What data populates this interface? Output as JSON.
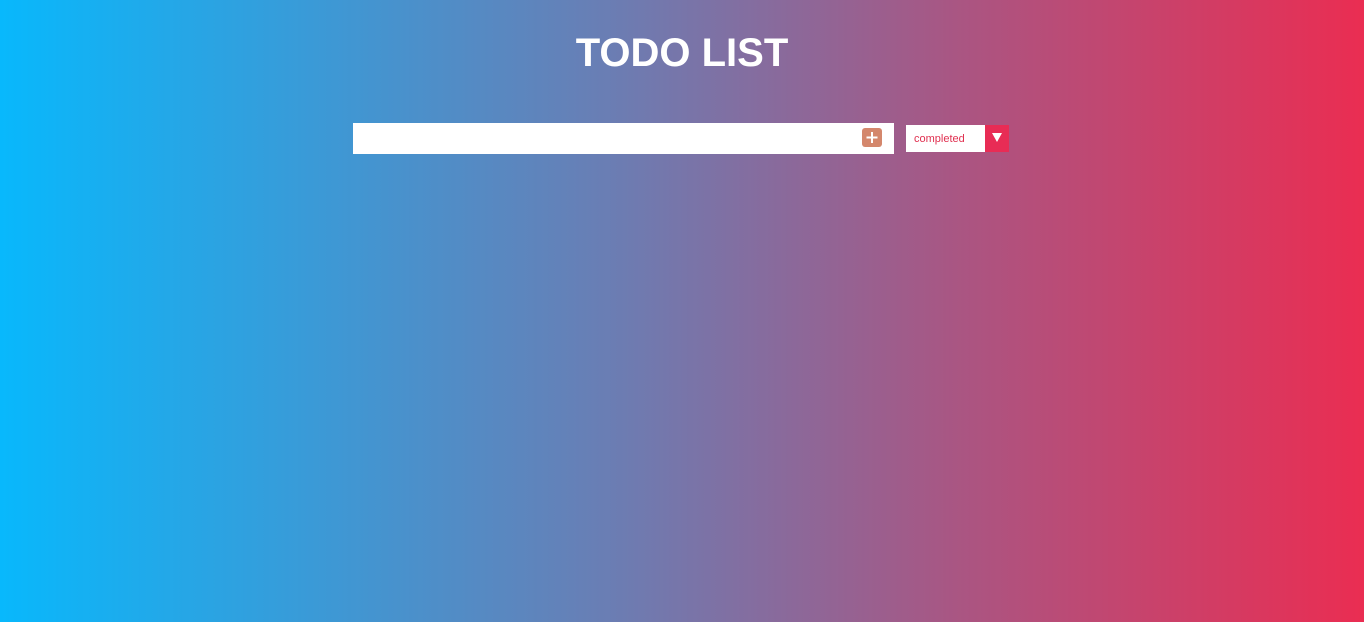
{
  "header": {
    "title": "TODO LIST"
  },
  "form": {
    "input_value": "",
    "input_placeholder": "",
    "add_icon": "plus-icon"
  },
  "filter": {
    "selected": "completed",
    "arrow_icon": "chevron-down-icon"
  },
  "colors": {
    "gradient_left": "#08b8fc",
    "gradient_right": "#ea2d52",
    "add_button": "#d4876c",
    "filter_accent": "#e82c55"
  }
}
